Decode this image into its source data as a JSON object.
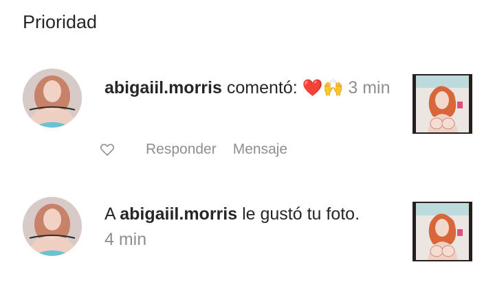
{
  "header": {
    "title": "Prioridad"
  },
  "notifications": [
    {
      "username": "abigaiil.morris",
      "action_text": " comentó: ",
      "comment_emojis": "❤️🙌",
      "time": "3 min",
      "avatar_icon": "profile-photo",
      "thumbnail_icon": "post-illustration",
      "actions": {
        "reply": "Responder",
        "message": "Mensaje"
      }
    },
    {
      "prefix": "A ",
      "username": "abigaiil.morris",
      "action_text": " le gustó tu foto.",
      "time": "4 min",
      "avatar_icon": "profile-photo",
      "thumbnail_icon": "post-illustration"
    }
  ],
  "colors": {
    "text": "#262626",
    "muted": "#8e8e8e",
    "heart": "#e0245e"
  }
}
